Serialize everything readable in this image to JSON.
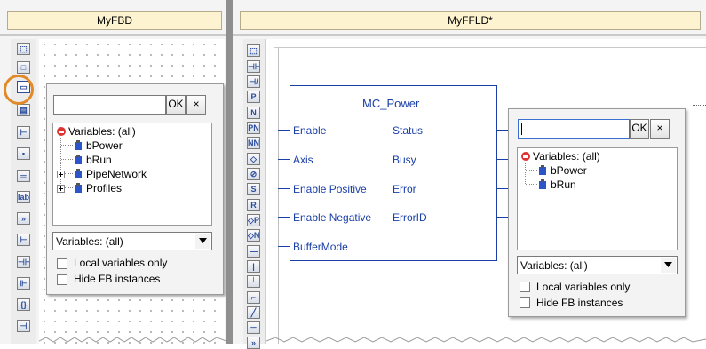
{
  "left_editor": {
    "tab_title": "MyFBD",
    "popup": {
      "search_value": "",
      "ok_label": "OK",
      "close_label": "×",
      "tree_root": "Variables: (all)",
      "tree_items": [
        "bPower",
        "bRun",
        "PipeNetwork",
        "Profiles"
      ],
      "filter_selected": "Variables: (all)",
      "local_only_label": "Local variables only",
      "hide_fb_label": "Hide FB instances"
    }
  },
  "right_editor": {
    "tab_title": "MyFFLD*",
    "block": {
      "name": "MC_Power",
      "inputs": [
        "Enable",
        "Axis",
        "Enable Positive",
        "Enable Negative",
        "BufferMode"
      ],
      "outputs": [
        "Status",
        "Busy",
        "Error",
        "ErrorID"
      ]
    },
    "popup": {
      "search_value": "",
      "ok_label": "OK",
      "close_label": "×",
      "tree_root": "Variables: (all)",
      "tree_items": [
        "bPower",
        "bRun"
      ],
      "filter_selected": "Variables: (all)",
      "local_only_label": "Local variables only",
      "hide_fb_label": "Hide FB instances"
    }
  },
  "colors": {
    "tab_bg": "#fdf3d0",
    "block_wire": "#1a3fa6",
    "highlight_ring": "#e08a2a"
  }
}
